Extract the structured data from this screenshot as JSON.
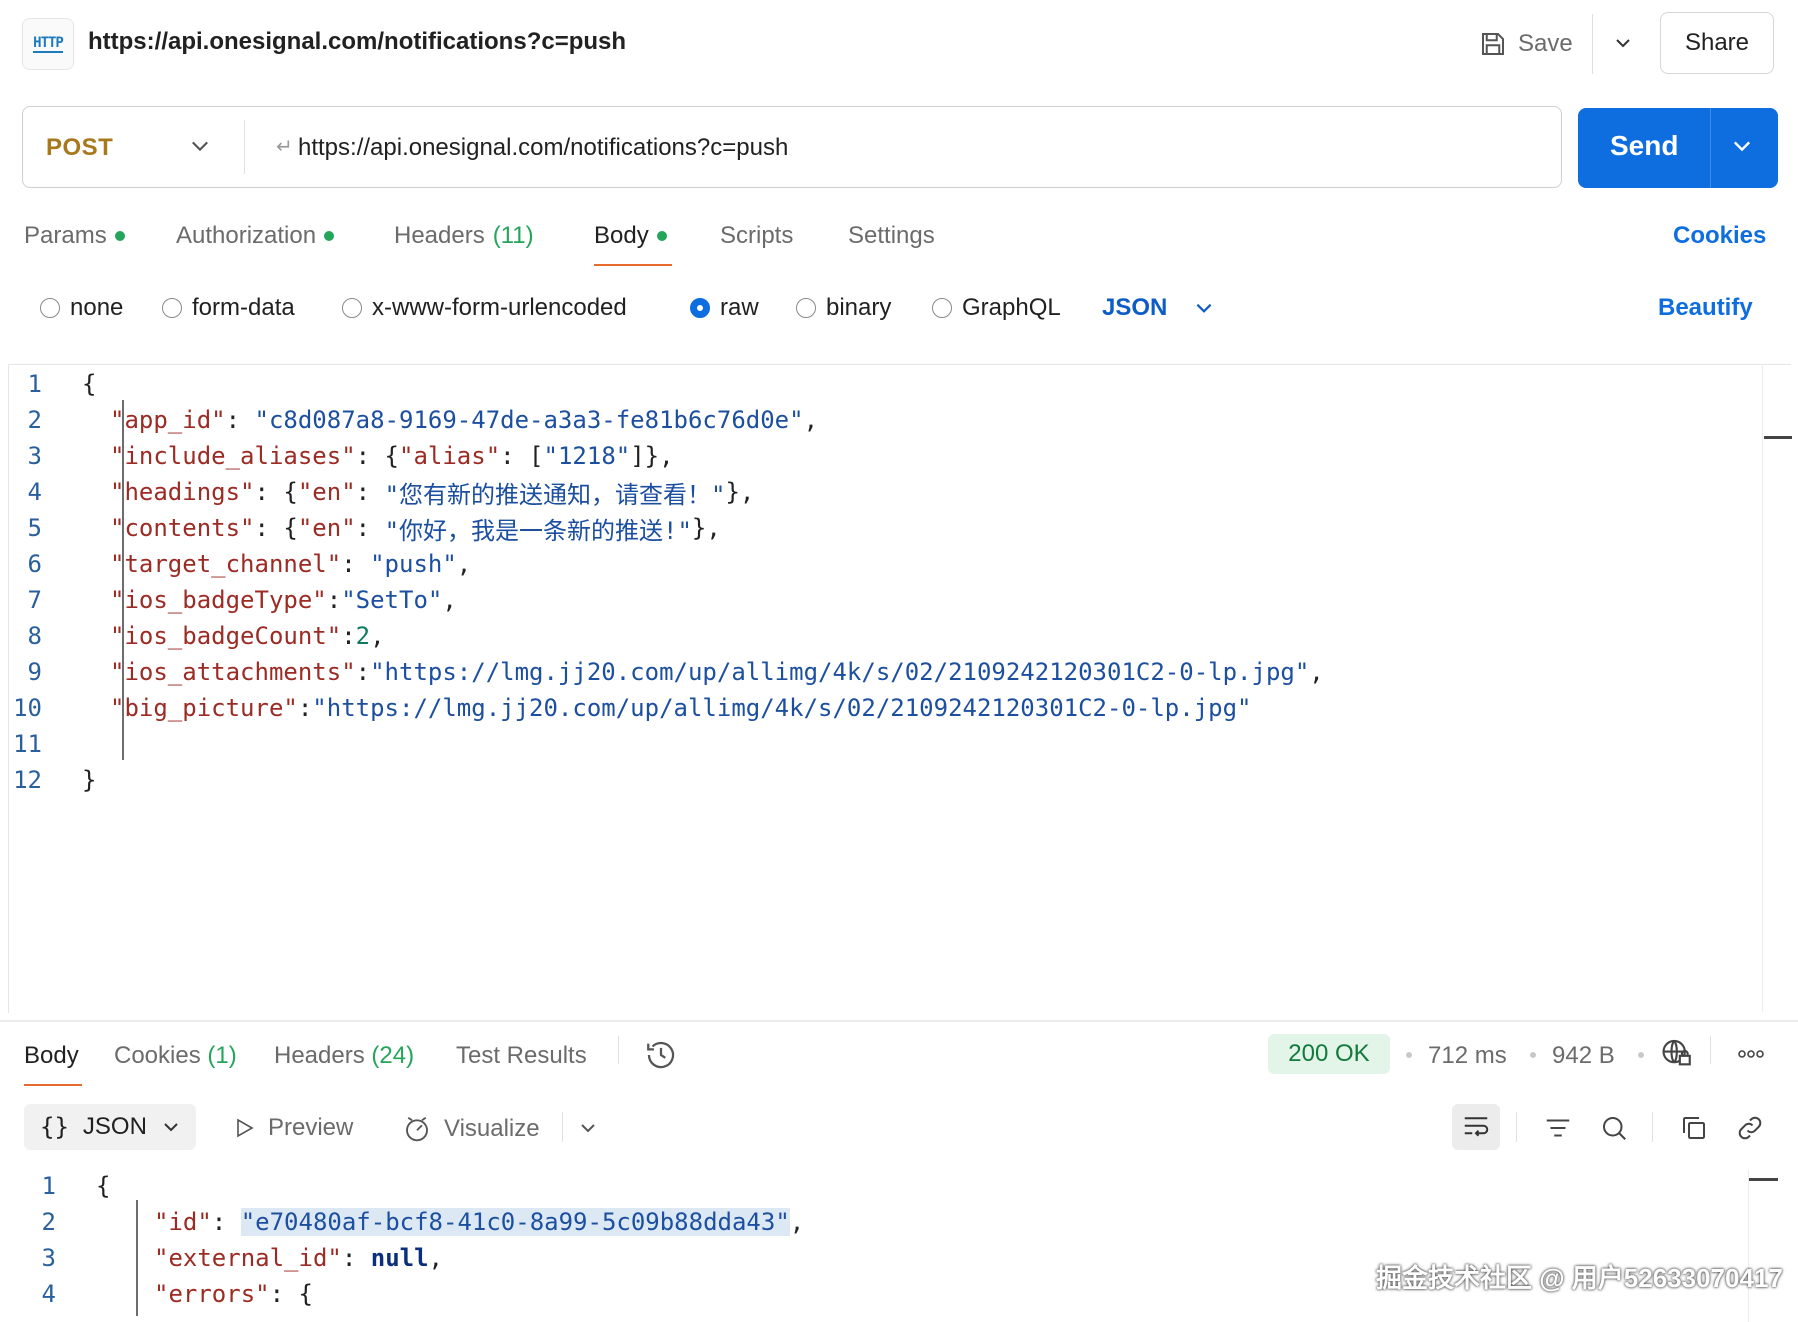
{
  "header": {
    "http_icon_text": "HTTP",
    "title": "https://api.onesignal.com/notifications?c=push",
    "save_label": "Save",
    "share_label": "Share"
  },
  "request": {
    "method": "POST",
    "url": "https://api.onesignal.com/notifications?c=push",
    "send_label": "Send"
  },
  "request_tabs": [
    {
      "label": "Params",
      "dot": true
    },
    {
      "label": "Authorization",
      "dot": true
    },
    {
      "label": "Headers",
      "count": "(11)"
    },
    {
      "label": "Body",
      "dot": true,
      "active": true
    },
    {
      "label": "Scripts"
    },
    {
      "label": "Settings"
    }
  ],
  "cookies_label": "Cookies",
  "body_types": [
    "none",
    "form-data",
    "x-www-form-urlencoded",
    "raw",
    "binary",
    "GraphQL"
  ],
  "body_type_selected": "raw",
  "format_label": "JSON",
  "beautify_label": "Beautify",
  "request_body": {
    "line_numbers": [
      "1",
      "2",
      "3",
      "4",
      "5",
      "6",
      "7",
      "8",
      "9",
      "10",
      "11",
      "12"
    ],
    "open": "{",
    "close": "}",
    "l2_key": "\"app_id\"",
    "l2_val": "\"c8d087a8-9169-47de-a3a3-fe81b6c76d0e\"",
    "l3_key": "\"include_aliases\"",
    "l3_k2": "\"alias\"",
    "l3_val": "\"1218\"",
    "l4_key": "\"headings\"",
    "l4_k2": "\"en\"",
    "l4_val": "\"您有新的推送通知，请查看！\"",
    "l5_key": "\"contents\"",
    "l5_k2": "\"en\"",
    "l5_val": "\"你好，我是一条新的推送!\"",
    "l6_key": "\"target_channel\"",
    "l6_val": "\"push\"",
    "l7_key": "\"ios_badgeType\"",
    "l7_val": "\"SetTo\"",
    "l8_key": "\"ios_badgeCount\"",
    "l8_val": "2",
    "l9_key": "\"ios_attachments\"",
    "l9_val": "\"https://lmg.jj20.com/up/allimg/4k/s/02/2109242120301C2-0-lp.jpg\"",
    "l10_key": "\"big_picture\"",
    "l10_val": "\"https://lmg.jj20.com/up/allimg/4k/s/02/2109242120301C2-0-lp.jpg\""
  },
  "response_tabs": [
    {
      "label": "Body",
      "active": true
    },
    {
      "label": "Cookies",
      "count": "(1)"
    },
    {
      "label": "Headers",
      "count": "(24)"
    },
    {
      "label": "Test Results"
    }
  ],
  "response_meta": {
    "status": "200 OK",
    "time": "712 ms",
    "size": "942 B",
    "status_color": "#127a3b"
  },
  "response_toolbar": {
    "format": "JSON",
    "preview": "Preview",
    "visualize": "Visualize"
  },
  "response_body": {
    "line_numbers": [
      "1",
      "2",
      "3",
      "4"
    ],
    "open": "{",
    "l2_key": "\"id\"",
    "l2_q1": "\"",
    "l2_val": "e70480af-bcf8-41c0-8a99-5c09b88dda43",
    "l2_q2": "\"",
    "l3_key": "\"external_id\"",
    "l3_val": "null",
    "l4_key": "\"errors\""
  },
  "watermark": "掘金技术社区 @ 用户52633070417",
  "colors": {
    "accent": "#0e6ddf",
    "tab_underline": "#e86a2c",
    "method": "#a8781c",
    "dot": "#23a55a"
  }
}
